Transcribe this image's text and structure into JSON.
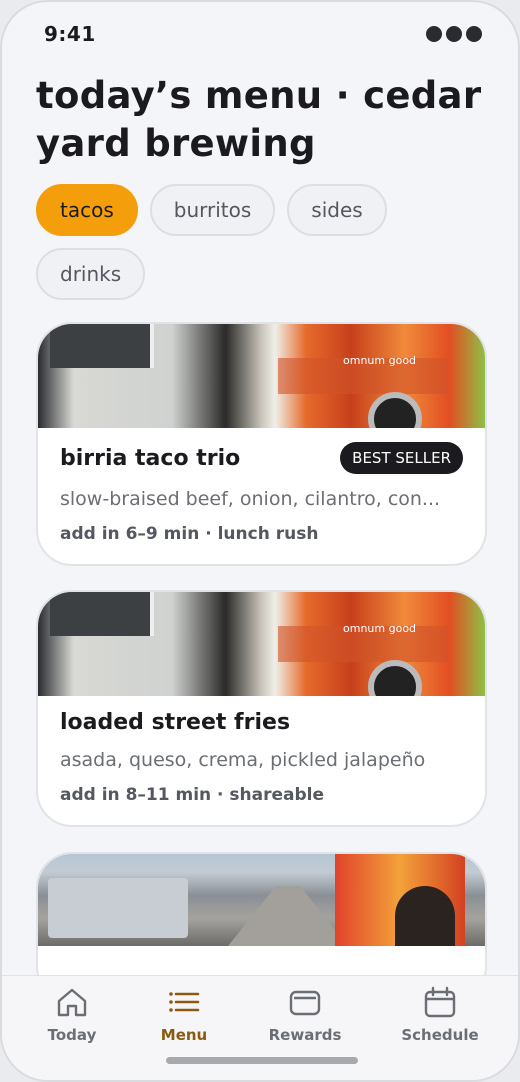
{
  "status": {
    "time": "9:41"
  },
  "header": {
    "title": "today’s menu · cedar yard brewing"
  },
  "filters": [
    {
      "label": "tacos",
      "active": true
    },
    {
      "label": "burritos",
      "active": false
    },
    {
      "label": "sides",
      "active": false
    },
    {
      "label": "drinks",
      "active": false
    }
  ],
  "cards": [
    {
      "title": "birria taco trio",
      "badge": "BEST SELLER",
      "description": "slow-braised beef, onion, cilantro, con...",
      "meta": "add in 6–9 min · lunch rush",
      "photo_sign": "omnum good"
    },
    {
      "title": "loaded street fries",
      "description": "asada, queso, crema, pickled jalapeño",
      "meta": "add in 8–11 min · shareable",
      "photo_sign": "omnum good"
    }
  ],
  "tabbar": {
    "today": "Today",
    "menu": "Menu",
    "rewards": "Rewards",
    "schedule": "Schedule",
    "active": "Menu"
  },
  "colors": {
    "accent": "#f59e0b",
    "active_tab": "#8a5a12",
    "dark": "#1b1b1f"
  }
}
